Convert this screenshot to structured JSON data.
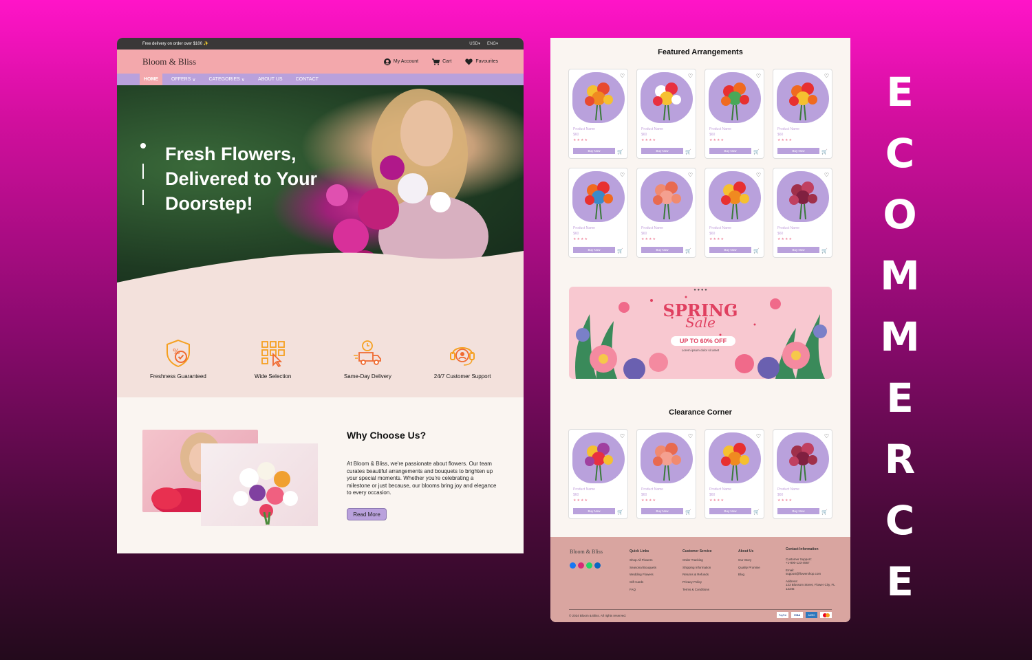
{
  "topbar": {
    "promo": "Free delivery on order over $100 ✨",
    "currency": "USD",
    "language": "ENG"
  },
  "header": {
    "logo": "Bloom & Bliss",
    "account": "My Account",
    "cart": "Cart",
    "favourites": "Favourites"
  },
  "nav": {
    "items": [
      "HOME",
      "OFFERS",
      "CATEGORIES",
      "ABOUT US",
      "CONTACT"
    ]
  },
  "hero": {
    "title": "Fresh Flowers, Delivered to Your Doorstep!"
  },
  "features": [
    {
      "label": "Freshness Guaranteed",
      "icon": "shield-percent-icon"
    },
    {
      "label": "Wide Selection",
      "icon": "grid-select-icon"
    },
    {
      "label": "Same-Day Delivery",
      "icon": "delivery-truck-icon"
    },
    {
      "label": "24/7 Customer Support",
      "icon": "headset-support-icon"
    }
  ],
  "why": {
    "title": "Why Choose Us?",
    "text": "At Bloom & Bliss, we're passionate about flowers. Our team curates beautiful arrangements and bouquets to brighten up your special moments. Whether you're celebrating a milestone or just because, our blooms bring joy and elegance to every occasion.",
    "button": "Read More"
  },
  "featured": {
    "title": "Featured Arrangements",
    "product_name": "Product Name",
    "price": "$60",
    "stars": "★★★★",
    "buy": "Buy Now"
  },
  "banner": {
    "spring": "SPRING",
    "sale": "Sale",
    "offer": "UP TO 60% OFF",
    "tagline": "Lorem ipsum dolor sit amet"
  },
  "clearance": {
    "title": "Clearance Corner"
  },
  "footer": {
    "logo": "Bloom & Bliss",
    "quick_links": {
      "title": "Quick Links",
      "items": [
        "Shop All Flowers",
        "Seasonal Bouquets",
        "Wedding Flowers",
        "Gift Cards",
        "FAQ"
      ]
    },
    "customer_service": {
      "title": "Customer Service",
      "items": [
        "Order Tracking",
        "Shipping Information",
        "Returns & Refunds",
        "Privacy Policy",
        "Terms & Conditions"
      ]
    },
    "about": {
      "title": "About Us",
      "items": [
        "Our Story",
        "Quality Promise",
        "Blog"
      ]
    },
    "contact": {
      "title": "Contact Information",
      "support_label": "Customer Support:",
      "phone": "+1-800-123-4567",
      "email_label": "Email:",
      "email": "support@flowershop.com",
      "address_label": "Address:",
      "address": "123 Blossom Street, Flower City, FL 12345"
    },
    "copyright": "© 2024 Bloom & Bliss. All rights reserved.",
    "payments": [
      "PayPal",
      "VISA",
      "AMEX",
      "MC"
    ]
  },
  "side_word": [
    "E",
    "C",
    "O",
    "M",
    "M",
    "E",
    "R",
    "C",
    "E"
  ],
  "colors": {
    "pink": "#f3a8ac",
    "lavender": "#b9a1dc",
    "cream": "#faf5f1",
    "footer": "#d9a5a0"
  }
}
